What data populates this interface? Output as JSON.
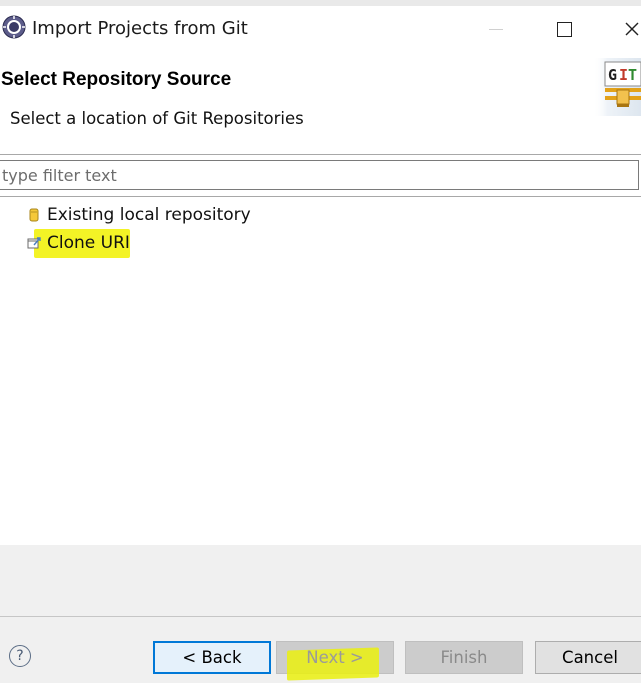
{
  "window": {
    "title": "Import Projects from Git"
  },
  "header": {
    "title": "Select Repository Source",
    "description": "Select a location of Git Repositories",
    "banner_text": "GIT"
  },
  "filter": {
    "placeholder": "type filter text",
    "value": ""
  },
  "tree": {
    "items": [
      {
        "label": "Existing local repository",
        "icon": "repository-icon",
        "highlighted": false
      },
      {
        "label": "Clone URI",
        "icon": "clone-uri-icon",
        "highlighted": true
      }
    ]
  },
  "footer": {
    "help_label": "?",
    "buttons": {
      "back": "< Back",
      "next": "Next >",
      "finish": "Finish",
      "cancel": "Cancel"
    }
  },
  "colors": {
    "highlight": "#f2f20e",
    "focus_border": "#0078d7",
    "disabled_button": "#cccccc"
  }
}
